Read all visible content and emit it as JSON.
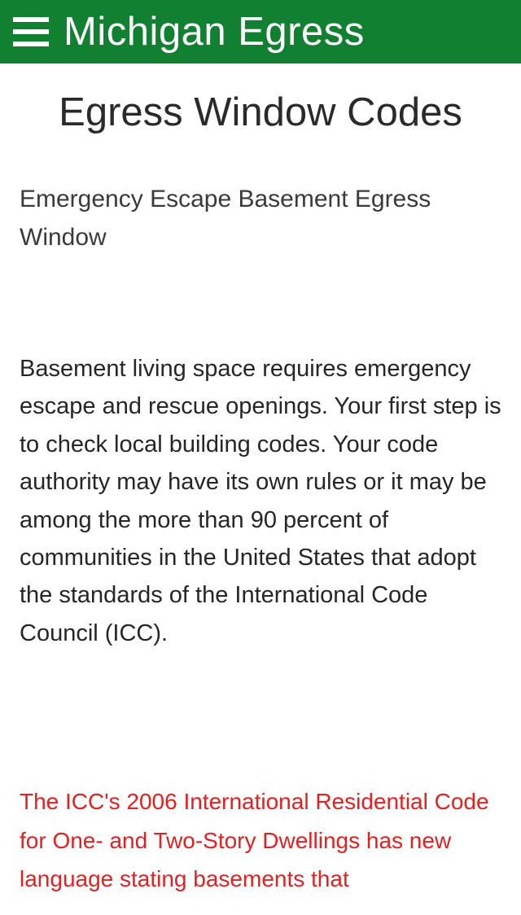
{
  "header": {
    "title": "Michigan Egress"
  },
  "content": {
    "page_title": "Egress Window Codes",
    "subtitle": "Emergency Escape Basement Egress Window",
    "body_paragraph": "Basement living space requires emergency escape and rescue openings. Your first step is to check local building codes. Your code authority may have its own rules or it may be among the more than 90 percent of communities in the United States that adopt the standards of the International Code Council (ICC).",
    "highlight_paragraph": "The ICC's 2006 International Residential Code for One- and Two-Story Dwellings has new language stating basements that"
  }
}
